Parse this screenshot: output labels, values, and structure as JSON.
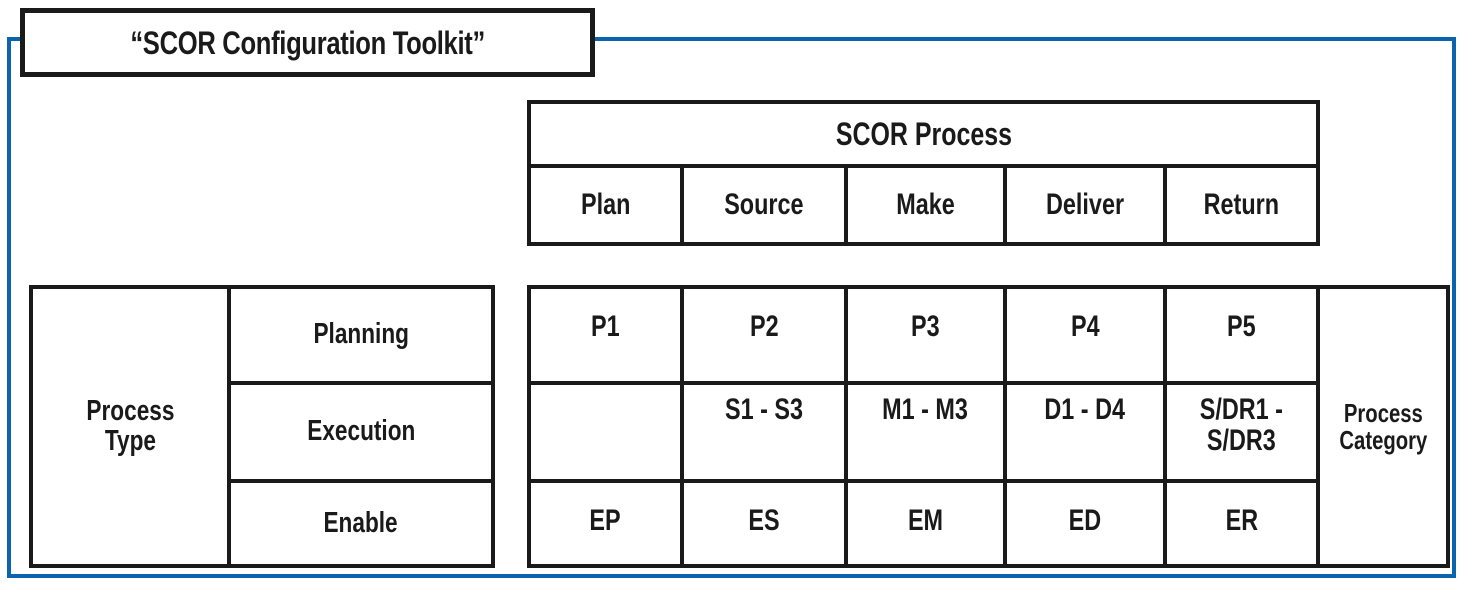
{
  "title": "“SCOR Configuration Toolkit”",
  "colors": {
    "frame_blue": "#0a65ae",
    "line_black": "#1a1a1a",
    "background": "#ffffff"
  },
  "scor_header": {
    "group_label": "SCOR Process",
    "columns": [
      "Plan",
      "Source",
      "Make",
      "Deliver",
      "Return"
    ]
  },
  "process_type": {
    "label": "Process\nType",
    "rows": [
      "Planning",
      "Execution",
      "Enable"
    ]
  },
  "process_category": {
    "label": "Process\nCategory"
  },
  "matrix": {
    "planning": [
      "P1",
      "P2",
      "P3",
      "P4",
      "P5"
    ],
    "execution": [
      "",
      "S1 - S3",
      "M1 - M3",
      "D1 - D4",
      "S/DR1 -\nS/DR3"
    ],
    "enable": [
      "EP",
      "ES",
      "EM",
      "ED",
      "ER"
    ]
  }
}
